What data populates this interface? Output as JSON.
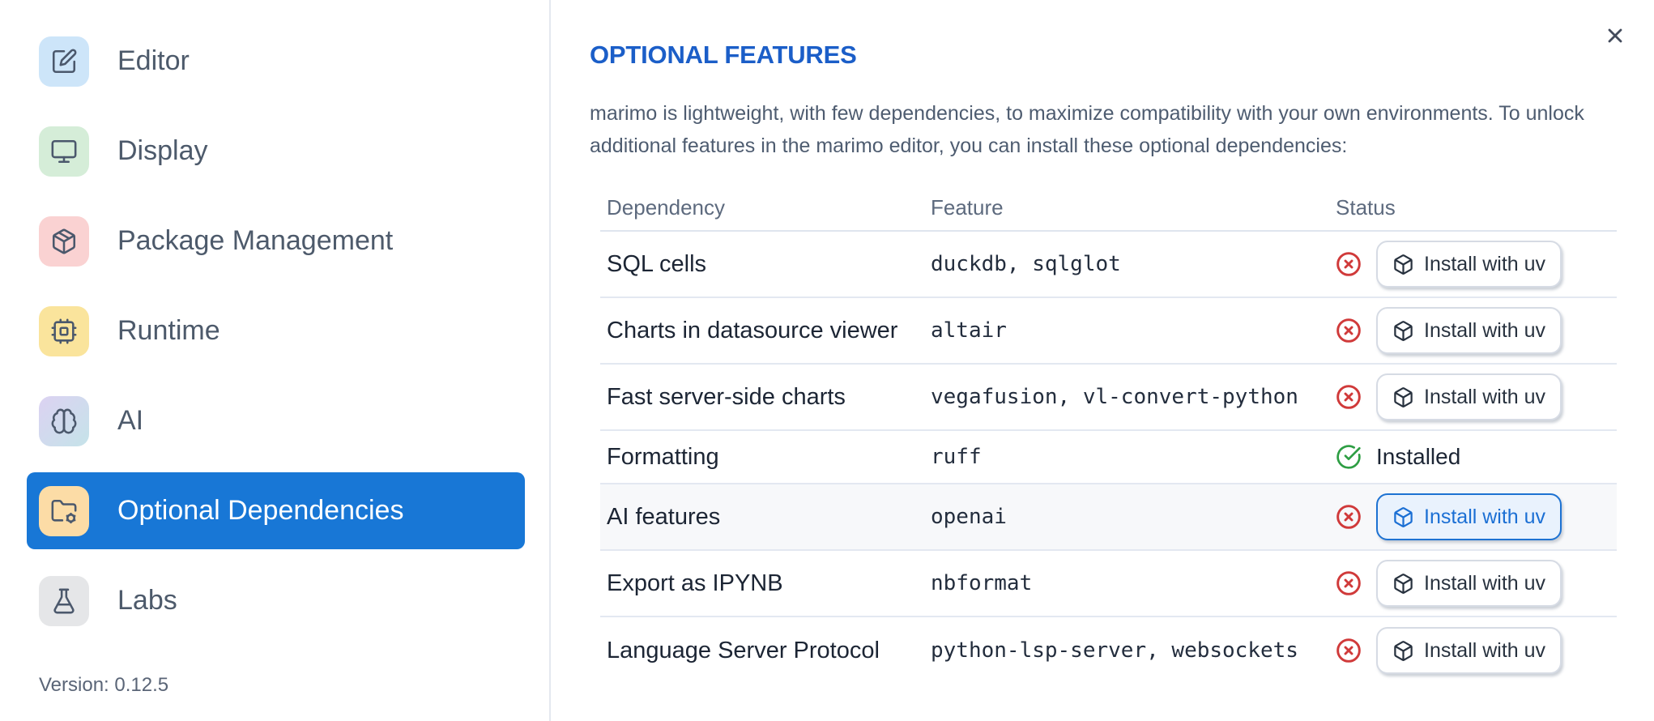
{
  "sidebar": {
    "items": [
      {
        "label": "Editor",
        "icon": "square-pen-icon",
        "icon_bg": "#cde5f9",
        "selected": false
      },
      {
        "label": "Display",
        "icon": "monitor-icon",
        "icon_bg": "#d5edd8",
        "selected": false
      },
      {
        "label": "Package Management",
        "icon": "package-icon",
        "icon_bg": "#fad2d2",
        "selected": false
      },
      {
        "label": "Runtime",
        "icon": "cpu-icon",
        "icon_bg": "#fae49c",
        "selected": false
      },
      {
        "label": "AI",
        "icon": "brain-icon",
        "icon_bg": "#dcd2f2",
        "icon_bg2": "#c5e3e9",
        "selected": false
      },
      {
        "label": "Optional Dependencies",
        "icon": "folder-cog-icon",
        "icon_bg": "#fcdca6",
        "selected": true
      },
      {
        "label": "Labs",
        "icon": "flask-icon",
        "icon_bg": "#e5e6e8",
        "selected": false
      }
    ],
    "version": "Version: 0.12.5"
  },
  "panel": {
    "title": "OPTIONAL FEATURES",
    "description": "marimo is lightweight, with few dependencies, to maximize compatibility with your own environments. To unlock additional features in the marimo editor, you can install these optional dependencies:",
    "close_icon": "x-icon"
  },
  "table": {
    "headers": [
      "Dependency",
      "Feature",
      "Status"
    ],
    "install_button_label": "Install with uv",
    "installed_label": "Installed",
    "rows": [
      {
        "dependency": "SQL cells",
        "feature": "duckdb, sqlglot",
        "status": "missing",
        "highlighted": false
      },
      {
        "dependency": "Charts in datasource viewer",
        "feature": "altair",
        "status": "missing",
        "highlighted": false
      },
      {
        "dependency": "Fast server-side charts",
        "feature": "vegafusion, vl-convert-python",
        "status": "missing",
        "highlighted": false
      },
      {
        "dependency": "Formatting",
        "feature": "ruff",
        "status": "installed",
        "highlighted": false
      },
      {
        "dependency": "AI features",
        "feature": "openai",
        "status": "missing",
        "highlighted": true
      },
      {
        "dependency": "Export as IPYNB",
        "feature": "nbformat",
        "status": "missing",
        "highlighted": false
      },
      {
        "dependency": "Language Server Protocol",
        "feature": "python-lsp-server, websockets",
        "status": "missing",
        "highlighted": false
      }
    ]
  },
  "colors": {
    "selected_item_bg": "#1877d6",
    "selected_item_text": "#ffffff",
    "title_blue": "#1b5ec8",
    "status_missing_red": "#d03a3a",
    "status_installed_green": "#2e9e44",
    "highlight_button_bg": "#e9f2fd",
    "highlight_button_border": "#1d72d2",
    "highlight_button_text": "#1b6fd4"
  }
}
